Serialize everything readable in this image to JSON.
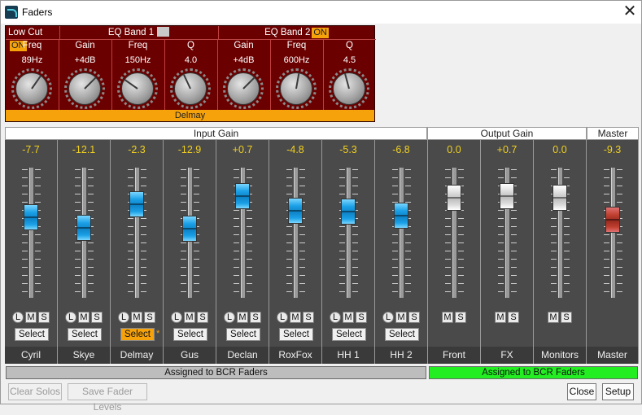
{
  "window": {
    "title": "Faders",
    "close_glyph": "✕"
  },
  "eq": {
    "sections": [
      {
        "label": "Low Cut",
        "badge": "ON",
        "state": "on"
      },
      {
        "label": "EQ Band 1",
        "badge": "",
        "state": "off"
      },
      {
        "label": "EQ Band 2",
        "badge": "ON",
        "state": "on"
      }
    ],
    "params": [
      {
        "label": "Freq",
        "value": "89Hz",
        "knob_rotation_deg": 35
      },
      {
        "label": "Gain",
        "value": "+4dB",
        "knob_rotation_deg": 45
      },
      {
        "label": "Freq",
        "value": "150Hz",
        "knob_rotation_deg": -55
      },
      {
        "label": "Q",
        "value": "4.0",
        "knob_rotation_deg": -25
      },
      {
        "label": "Gain",
        "value": "+4dB",
        "knob_rotation_deg": 45
      },
      {
        "label": "Freq",
        "value": "600Hz",
        "knob_rotation_deg": 10
      },
      {
        "label": "Q",
        "value": "4.5",
        "knob_rotation_deg": -15
      }
    ],
    "channel": "Delmay"
  },
  "groups": {
    "input": "Input Gain",
    "output": "Output Gain",
    "master": "Master"
  },
  "colors": {
    "eq_bg": "#6b0000",
    "accent": "#f5a20b",
    "db_text": "#f0d020",
    "assigned_green": "#22ee22",
    "assigned_gray": "#bdbdbd"
  },
  "strips": [
    {
      "name": "Cyril",
      "db": "-7.7",
      "level": 0.62,
      "cap": "blue",
      "has_l": true,
      "select": "Select",
      "selected": false
    },
    {
      "name": "Skye",
      "db": "-12.1",
      "level": 0.54,
      "cap": "blue",
      "has_l": true,
      "select": "Select",
      "selected": false
    },
    {
      "name": "Delmay",
      "db": "-2.3",
      "level": 0.72,
      "cap": "blue",
      "has_l": true,
      "select": "Select",
      "selected": true,
      "marker": "*"
    },
    {
      "name": "Gus",
      "db": "-12.9",
      "level": 0.53,
      "cap": "blue",
      "has_l": true,
      "select": "Select",
      "selected": false
    },
    {
      "name": "Declan",
      "db": "+0.7",
      "level": 0.78,
      "cap": "blue",
      "has_l": true,
      "select": "Select",
      "selected": false
    },
    {
      "name": "RoxFox",
      "db": "-4.8",
      "level": 0.67,
      "cap": "blue",
      "has_l": true,
      "select": "Select",
      "selected": false
    },
    {
      "name": "HH 1",
      "db": "-5.3",
      "level": 0.66,
      "cap": "blue",
      "has_l": true,
      "select": "Select",
      "selected": false
    },
    {
      "name": "HH 2",
      "db": "-6.8",
      "level": 0.63,
      "cap": "blue",
      "has_l": true,
      "select": "Select",
      "selected": false
    },
    {
      "name": "Front",
      "db": "0.0",
      "level": 0.77,
      "cap": "white",
      "has_l": false,
      "select": "",
      "selected": false
    },
    {
      "name": "FX",
      "db": "+0.7",
      "level": 0.78,
      "cap": "white",
      "has_l": false,
      "select": "",
      "selected": false
    },
    {
      "name": "Monitors",
      "db": "0.0",
      "level": 0.77,
      "cap": "white",
      "has_l": false,
      "select": "",
      "selected": false
    },
    {
      "name": "Master",
      "db": "-9.3",
      "level": 0.6,
      "cap": "red",
      "has_l": false,
      "has_ms": false,
      "select": "",
      "selected": false
    }
  ],
  "lms_labels": {
    "l": "L",
    "m": "M",
    "s": "S"
  },
  "assigned": {
    "input": "Assigned to BCR Faders",
    "output": "Assigned to BCR Faders"
  },
  "buttons": {
    "clear_solos": "Clear Solos",
    "save_fader_levels": "Save Fader Levels",
    "close": "Close",
    "setup": "Setup"
  }
}
